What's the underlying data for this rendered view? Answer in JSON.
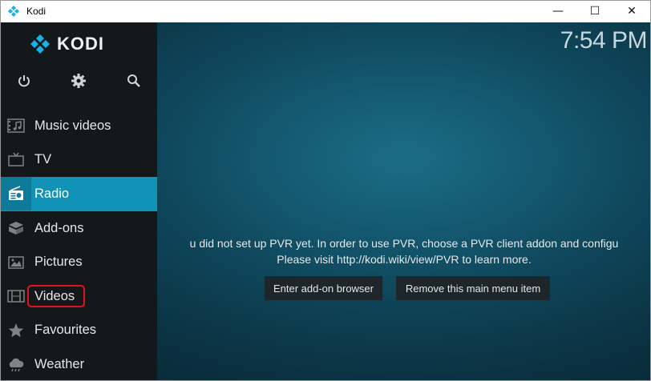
{
  "window": {
    "title": "Kodi",
    "controls": {
      "minimize": "—",
      "maximize": "☐",
      "close": "✕"
    }
  },
  "logo": {
    "text": "KODI"
  },
  "top_icons": [
    "power-icon",
    "gear-icon",
    "search-icon"
  ],
  "clock": "7:54 PM",
  "menu": {
    "items": [
      {
        "label": "Music videos",
        "icon": "music-video-icon"
      },
      {
        "label": "TV",
        "icon": "tv-icon"
      },
      {
        "label": "Radio",
        "icon": "radio-icon",
        "active": true
      },
      {
        "label": "Add-ons",
        "icon": "addons-box-icon"
      },
      {
        "label": "Pictures",
        "icon": "pictures-icon"
      },
      {
        "label": "Videos",
        "icon": "film-strip-icon",
        "highlighted": true
      },
      {
        "label": "Favourites",
        "icon": "star-icon"
      },
      {
        "label": "Weather",
        "icon": "cloud-icon"
      }
    ]
  },
  "message": {
    "line1": "u did not set up PVR yet. In order to use PVR, choose a PVR client addon and configu",
    "line2": "Please visit http://kodi.wiki/view/PVR to learn more."
  },
  "buttons": {
    "addon_browser": "Enter add-on browser",
    "remove_item": "Remove this main menu item"
  },
  "colors": {
    "sidebar_bg": "#15181b",
    "active_item": "#1193b7",
    "highlight_outline": "#e0141e",
    "background_center": "#1c6c86"
  }
}
